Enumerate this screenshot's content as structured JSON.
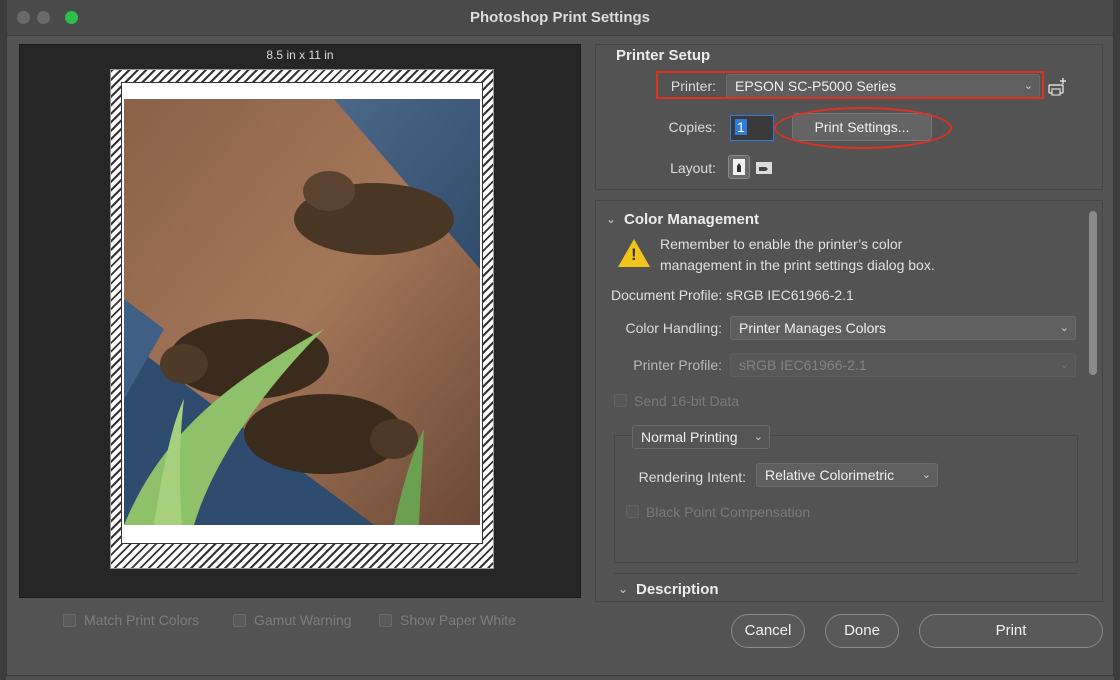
{
  "window": {
    "title": "Photoshop Print Settings"
  },
  "preview": {
    "paper_size": "8.5 in x 11 in"
  },
  "preview_options": {
    "match_print_colors": "Match Print Colors",
    "gamut_warning": "Gamut Warning",
    "show_paper_white": "Show Paper White"
  },
  "printer_setup": {
    "title": "Printer Setup",
    "printer_label": "Printer:",
    "printer_value": "EPSON SC-P5000 Series",
    "copies_label": "Copies:",
    "copies_value": "1",
    "print_settings_button": "Print Settings...",
    "layout_label": "Layout:"
  },
  "color_management": {
    "title": "Color Management",
    "warning_line1": "Remember to enable the printer’s color",
    "warning_line2": "management in the print settings dialog box.",
    "document_profile": "Document Profile: sRGB IEC61966-2.1",
    "color_handling_label": "Color Handling:",
    "color_handling_value": "Printer Manages Colors",
    "printer_profile_label": "Printer Profile:",
    "printer_profile_value": "sRGB IEC61966-2.1",
    "send_16bit": "Send 16-bit Data",
    "printing_mode": "Normal Printing",
    "rendering_intent_label": "Rendering Intent:",
    "rendering_intent_value": "Relative Colorimetric",
    "black_point": "Black Point Compensation"
  },
  "description": {
    "title": "Description"
  },
  "footer": {
    "cancel": "Cancel",
    "done": "Done",
    "print": "Print"
  },
  "colors": {
    "accent_red": "#e0301e",
    "selection_blue": "#2f7bdc",
    "warning_yellow": "#f0c419"
  }
}
